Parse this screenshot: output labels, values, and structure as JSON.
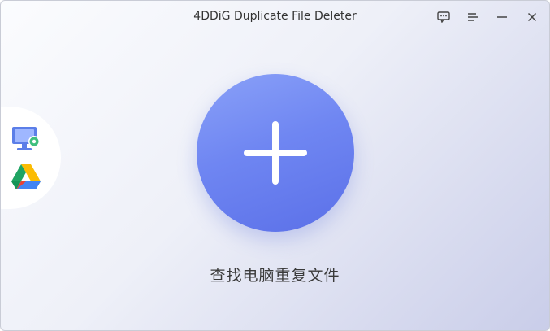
{
  "window": {
    "title": "4DDiG Duplicate File Deleter"
  },
  "titlebar_icons": [
    "feedback-icon",
    "menu-icon",
    "minimize-icon",
    "close-icon"
  ],
  "side_panel": {
    "items": [
      {
        "icon": "computer-icon"
      },
      {
        "icon": "google-drive-icon"
      }
    ]
  },
  "main": {
    "action_label": "查找电脑重复文件",
    "action_icon": "plus-icon"
  },
  "colors": {
    "accent": "#6f86f2",
    "accent_dark": "#5b70e8",
    "background_start": "#fbfcfe",
    "background_end": "#c9cde9"
  }
}
